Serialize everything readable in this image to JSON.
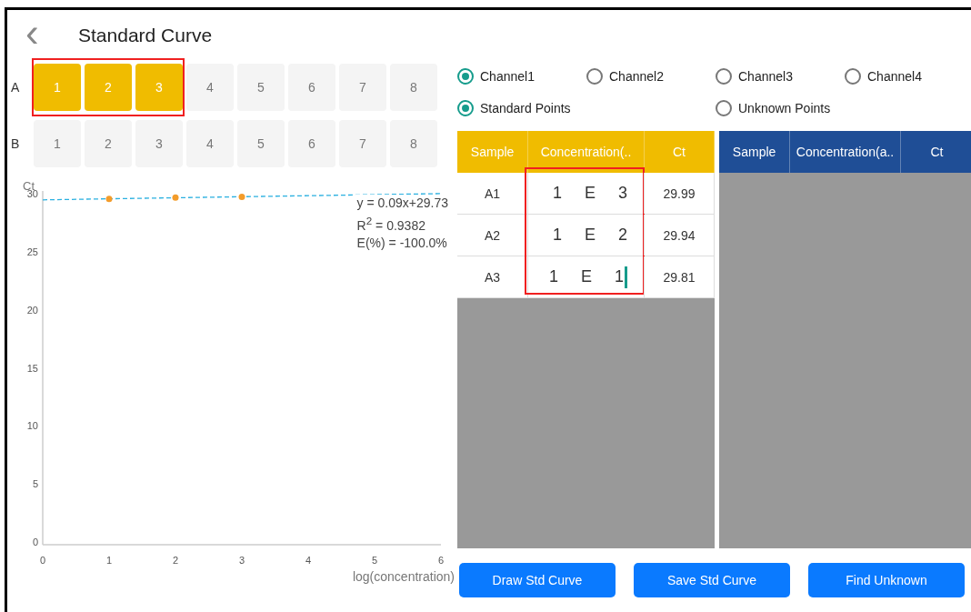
{
  "header": {
    "back": "‹",
    "title": "Standard Curve"
  },
  "plate": {
    "rows": [
      {
        "label": "A",
        "highlighted": true,
        "wells": [
          {
            "label": "1",
            "selected": true
          },
          {
            "label": "2",
            "selected": true
          },
          {
            "label": "3",
            "selected": true
          },
          {
            "label": "4",
            "selected": false
          },
          {
            "label": "5",
            "selected": false
          },
          {
            "label": "6",
            "selected": false
          },
          {
            "label": "7",
            "selected": false
          },
          {
            "label": "8",
            "selected": false
          }
        ]
      },
      {
        "label": "B",
        "highlighted": false,
        "wells": [
          {
            "label": "1",
            "selected": false
          },
          {
            "label": "2",
            "selected": false
          },
          {
            "label": "3",
            "selected": false
          },
          {
            "label": "4",
            "selected": false
          },
          {
            "label": "5",
            "selected": false
          },
          {
            "label": "6",
            "selected": false
          },
          {
            "label": "7",
            "selected": false
          },
          {
            "label": "8",
            "selected": false
          }
        ]
      }
    ]
  },
  "chart": {
    "chart_data": {
      "type": "scatter",
      "ylabel": "Ct",
      "xlabel": "log(concentration)",
      "xlim": [
        0,
        6
      ],
      "ylim": [
        0,
        30.5
      ],
      "xticks": [
        0,
        1,
        2,
        3,
        4,
        5,
        6
      ],
      "yticks": [
        0,
        5,
        10,
        15,
        20,
        25,
        30
      ],
      "series": [
        {
          "color": "#f39c2b",
          "x": [
            1,
            2,
            3
          ],
          "values": [
            29.81,
            29.94,
            29.99
          ]
        }
      ],
      "annotations": [
        "y = 0.09x+29.73",
        "R$^{2}$ = 0.9382",
        "E(%) = -100.0%"
      ]
    }
  },
  "channels": [
    {
      "label": "Channel1",
      "selected": true
    },
    {
      "label": "Channel2",
      "selected": false
    },
    {
      "label": "Channel3",
      "selected": false
    },
    {
      "label": "Channel4",
      "selected": false
    }
  ],
  "point_types": [
    {
      "label": "Standard Points",
      "selected": true
    },
    {
      "label": "Unknown Points",
      "selected": false
    }
  ],
  "standard_table": {
    "columns": [
      "Sample",
      "Concentration(..",
      "Ct"
    ],
    "concentration_highlighted": true,
    "rows": [
      {
        "sample": "A1",
        "concentration": "1 E 3",
        "ct": "29.99",
        "focused": false
      },
      {
        "sample": "A2",
        "concentration": "1 E 2",
        "ct": "29.94",
        "focused": false
      },
      {
        "sample": "A3",
        "concentration": "1 E 1",
        "ct": "29.81",
        "focused": true
      }
    ]
  },
  "unknown_table": {
    "columns": [
      "Sample",
      "Concentration(a..",
      "Ct"
    ]
  },
  "buttons": [
    "Draw Std Curve",
    "Save Std Curve",
    "Find Unknown"
  ]
}
